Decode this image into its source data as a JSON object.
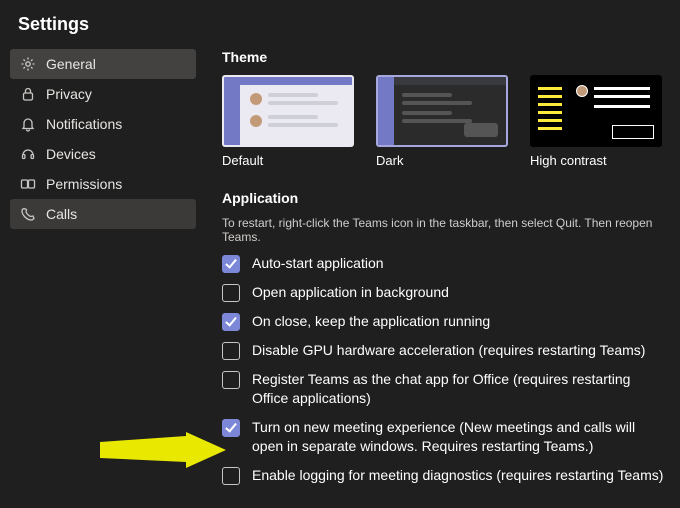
{
  "title": "Settings",
  "sidebar": {
    "items": [
      {
        "label": "General",
        "icon": "gear-icon",
        "state": "active"
      },
      {
        "label": "Privacy",
        "icon": "lock-icon",
        "state": ""
      },
      {
        "label": "Notifications",
        "icon": "bell-icon",
        "state": ""
      },
      {
        "label": "Devices",
        "icon": "headset-icon",
        "state": ""
      },
      {
        "label": "Permissions",
        "icon": "permissions-icon",
        "state": ""
      },
      {
        "label": "Calls",
        "icon": "phone-icon",
        "state": "hover"
      }
    ]
  },
  "theme": {
    "heading": "Theme",
    "selected": 1,
    "options": [
      {
        "label": "Default"
      },
      {
        "label": "Dark"
      },
      {
        "label": "High contrast"
      }
    ]
  },
  "application": {
    "heading": "Application",
    "helper": "To restart, right-click the Teams icon in the taskbar, then select Quit. Then reopen Teams.",
    "options": [
      {
        "checked": true,
        "label": "Auto-start application"
      },
      {
        "checked": false,
        "label": "Open application in background"
      },
      {
        "checked": true,
        "label": "On close, keep the application running"
      },
      {
        "checked": false,
        "label": "Disable GPU hardware acceleration (requires restarting Teams)"
      },
      {
        "checked": false,
        "label": "Register Teams as the chat app for Office (requires restarting Office applications)"
      },
      {
        "checked": true,
        "label": "Turn on new meeting experience (New meetings and calls will open in separate windows. Requires restarting Teams.)"
      },
      {
        "checked": false,
        "label": "Enable logging for meeting diagnostics (requires restarting Teams)"
      }
    ]
  }
}
